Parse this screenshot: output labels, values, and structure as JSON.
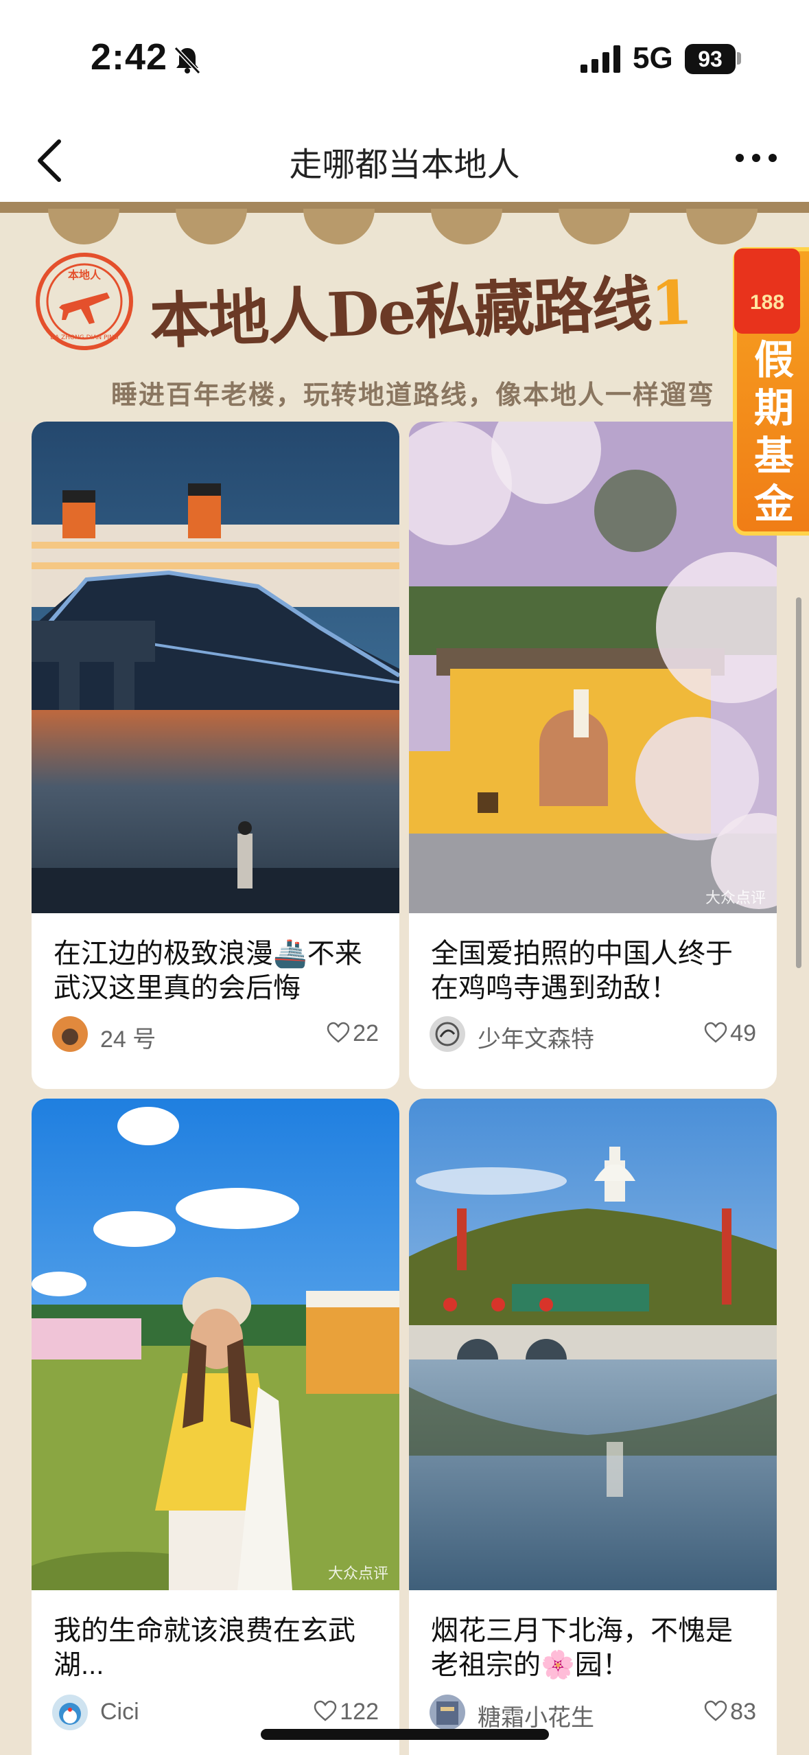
{
  "status_bar": {
    "time": "2:42",
    "network": "5G",
    "battery": "93"
  },
  "nav": {
    "title": "走哪都当本地人",
    "back_icon": "chevron-left-icon",
    "more_icon": "ellipsis-icon"
  },
  "banner": {
    "stamp_text": "本地人",
    "stamp_subtext": "DA ZHONG DIAN PING",
    "title_main": "本地人De私藏路线",
    "title_accent": "1",
    "subtitle": "睡进百年老楼，玩转地道路线，像本地人一样遛弯",
    "fund_amount": "188",
    "fund_label": "假期基金"
  },
  "cards": [
    {
      "title": "在江边的极致浪漫🚢不来武汉这里真的会后悔",
      "author": "24 号",
      "likes": "22",
      "watermark": ""
    },
    {
      "title": "全国爱拍照的中国人终于在鸡鸣寺遇到劲敌！",
      "author": "少年文森特",
      "likes": "49",
      "watermark": "大众点评"
    },
    {
      "title": "我的生命就该浪费在玄武湖...",
      "author": "Cici",
      "likes": "122",
      "watermark": "大众点评"
    },
    {
      "title": "烟花三月下北海，不愧是老祖宗的🌸园！",
      "author": "糖霜小花生",
      "likes": "83",
      "watermark": ""
    }
  ],
  "colors": {
    "background": "#ede3d2",
    "banner_brown": "#6b3a26",
    "accent_orange": "#f5a623",
    "fund_red": "#e8331c"
  }
}
